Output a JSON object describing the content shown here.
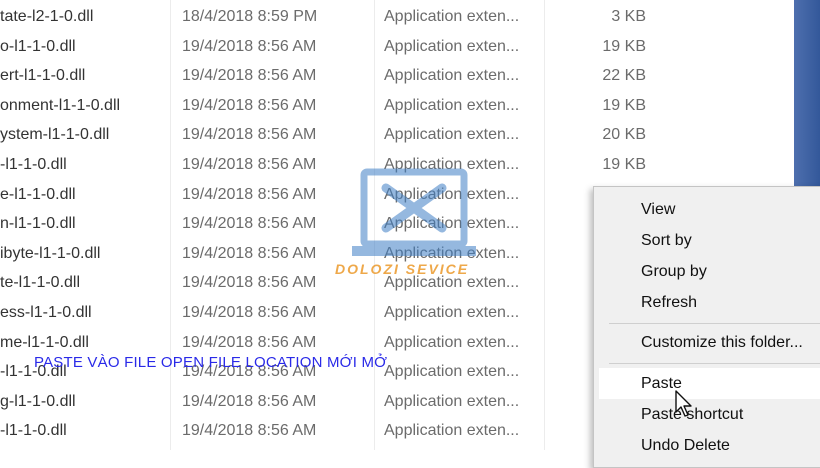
{
  "files": [
    {
      "name": "tate-l2-1-0.dll",
      "date": "18/4/2018 8:59 PM",
      "type": "Application exten...",
      "size": "3 KB"
    },
    {
      "name": "o-l1-1-0.dll",
      "date": "19/4/2018 8:56 AM",
      "type": "Application exten...",
      "size": "19 KB"
    },
    {
      "name": "ert-l1-1-0.dll",
      "date": "19/4/2018 8:56 AM",
      "type": "Application exten...",
      "size": "22 KB"
    },
    {
      "name": "onment-l1-1-0.dll",
      "date": "19/4/2018 8:56 AM",
      "type": "Application exten...",
      "size": "19 KB"
    },
    {
      "name": "ystem-l1-1-0.dll",
      "date": "19/4/2018 8:56 AM",
      "type": "Application exten...",
      "size": "20 KB"
    },
    {
      "name": "-l1-1-0.dll",
      "date": "19/4/2018 8:56 AM",
      "type": "Application exten...",
      "size": "19 KB"
    },
    {
      "name": "e-l1-1-0.dll",
      "date": "19/4/2018 8:56 AM",
      "type": "Application exten...",
      "size": ""
    },
    {
      "name": "n-l1-1-0.dll",
      "date": "19/4/2018 8:56 AM",
      "type": "Application exten...",
      "size": ""
    },
    {
      "name": "ibyte-l1-1-0.dll",
      "date": "19/4/2018 8:56 AM",
      "type": "Application exten...",
      "size": ""
    },
    {
      "name": "te-l1-1-0.dll",
      "date": "19/4/2018 8:56 AM",
      "type": "Application exten...",
      "size": ""
    },
    {
      "name": "ess-l1-1-0.dll",
      "date": "19/4/2018 8:56 AM",
      "type": "Application exten...",
      "size": ""
    },
    {
      "name": "me-l1-1-0.dll",
      "date": "19/4/2018 8:56 AM",
      "type": "Application exten...",
      "size": ""
    },
    {
      "name": "-l1-1-0.dll",
      "date": "19/4/2018 8:56 AM",
      "type": "Application exten...",
      "size": ""
    },
    {
      "name": "g-l1-1-0.dll",
      "date": "19/4/2018 8:56 AM",
      "type": "Application exten...",
      "size": ""
    },
    {
      "name": "-l1-1-0.dll",
      "date": "19/4/2018 8:56 AM",
      "type": "Application exten...",
      "size": ""
    }
  ],
  "context_menu": {
    "view": "View",
    "sort_by": "Sort by",
    "group_by": "Group by",
    "refresh": "Refresh",
    "customize": "Customize this folder...",
    "paste": "Paste",
    "paste_shortcut": "Paste shortcut",
    "undo_delete": "Undo Delete"
  },
  "overlay": {
    "caption": "PASTE VÀO FILE OPEN FILE LOCATION MỚI MỞ",
    "watermark_brand": "DOLOZI SEVICE",
    "watermark_icon": "laptop-tools-logo"
  },
  "colors": {
    "caption": "#2a2ae8",
    "watermark_orange": "#ec9a2b",
    "watermark_blue": "#3f7fc6",
    "scrollbar_blue": "#33589a"
  }
}
